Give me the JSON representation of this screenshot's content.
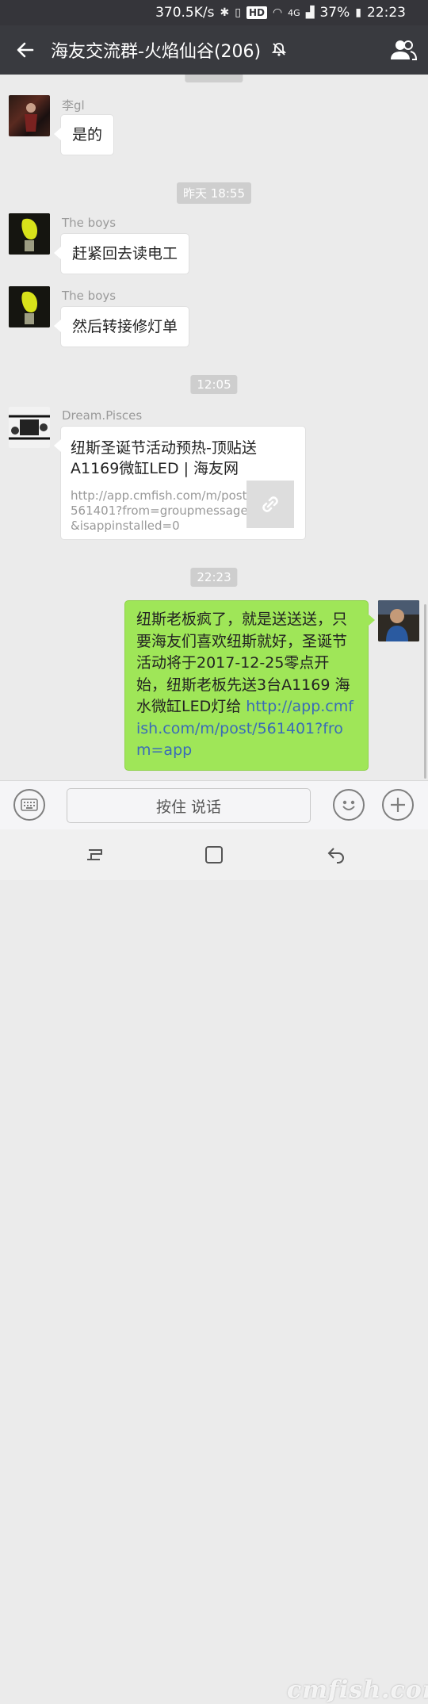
{
  "status_bar": {
    "speed": "370.5K/s",
    "hd_badge": "HD",
    "network": "4G",
    "battery": "37%",
    "time": "22:23"
  },
  "header": {
    "title": "海友交流群-火焰仙谷(206)",
    "icons": [
      "back-arrow-icon",
      "mute-bell-icon",
      "group-members-icon"
    ]
  },
  "messages": [
    {
      "type": "text",
      "side": "left",
      "sender": "李gl",
      "text": "是的"
    },
    {
      "type": "timestamp",
      "text": "昨天 18:55"
    },
    {
      "type": "text",
      "side": "left",
      "sender": "The  boys",
      "text": "赶紧回去读电工"
    },
    {
      "type": "text",
      "side": "left",
      "sender": "The  boys",
      "text": "然后转接修灯单"
    },
    {
      "type": "timestamp",
      "text": "12:05"
    },
    {
      "type": "link",
      "side": "left",
      "sender": "Dream.Pisces",
      "title": "纽斯圣诞节活动预热-顶贴送A1169微缸LED | 海友网",
      "desc": "http://app.cmfish.com/m/post/561401?from=groupmessage&isappinstalled=0"
    },
    {
      "type": "timestamp",
      "text": "22:23"
    },
    {
      "type": "text",
      "side": "right",
      "text": "纽斯老板疯了，就是送送送，只要海友们喜欢纽斯就好，圣诞节活动将于2017-12-25零点开始，纽斯老板先送3台A1169 海水微缸LED灯给",
      "link": "http://app.cmfish.com/m/post/561401?from=app"
    }
  ],
  "input_bar": {
    "hold_to_talk": "按住 说话",
    "icons": [
      "keyboard-icon",
      "emoji-icon",
      "plus-icon"
    ]
  },
  "watermark": "cmfish.com",
  "colors": {
    "header_bg": "#393a3f",
    "chat_bg": "#ebebeb",
    "self_bubble": "#9fe658",
    "link": "#3a6bb8"
  }
}
